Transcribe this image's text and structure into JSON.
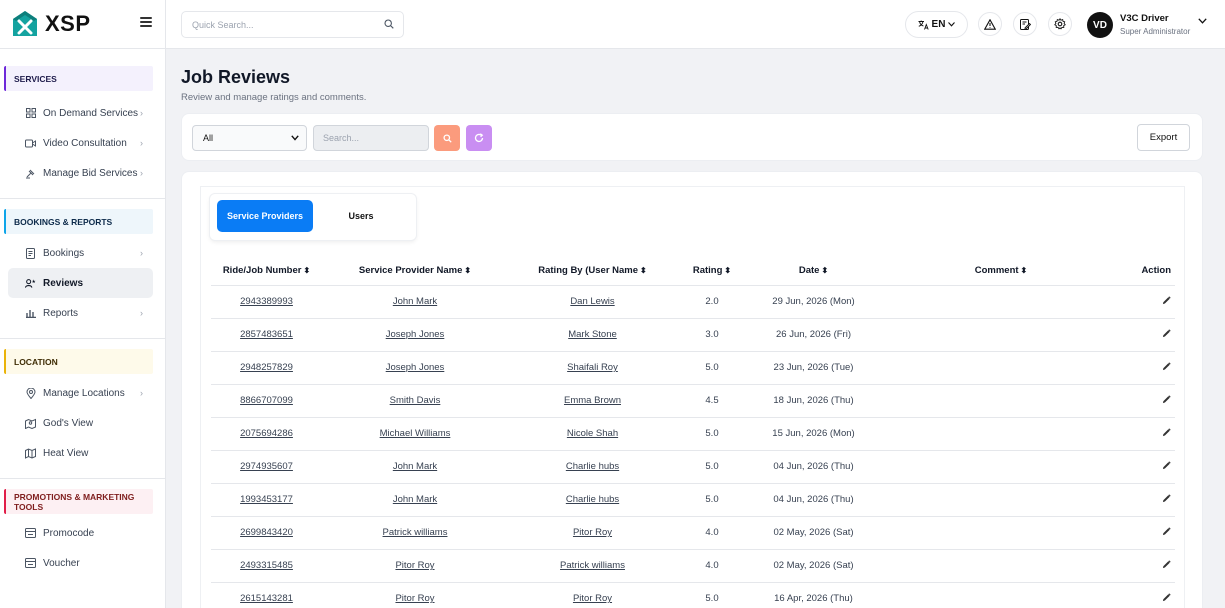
{
  "brand": {
    "name": "XSP"
  },
  "sidebar": {
    "sections": [
      {
        "title": "SERVICES",
        "items": [
          {
            "label": "On Demand Services",
            "chevron": true
          },
          {
            "label": "Video Consultation",
            "chevron": true
          },
          {
            "label": "Manage Bid Services",
            "chevron": true
          }
        ]
      },
      {
        "title": "BOOKINGS & REPORTS",
        "items": [
          {
            "label": "Bookings",
            "chevron": true
          },
          {
            "label": "Reviews",
            "active": true
          },
          {
            "label": "Reports",
            "chevron": true
          }
        ]
      },
      {
        "title": "LOCATION",
        "items": [
          {
            "label": "Manage Locations",
            "chevron": true
          },
          {
            "label": "God's View"
          },
          {
            "label": "Heat View"
          }
        ]
      },
      {
        "title": "PROMOTIONS & MARKETING TOOLS",
        "items": [
          {
            "label": "Promocode"
          },
          {
            "label": "Voucher"
          }
        ]
      }
    ]
  },
  "topbar": {
    "search_placeholder": "Quick Search...",
    "language": "EN",
    "user": {
      "initials": "VD",
      "name": "V3C Driver",
      "role": "Super Administrator"
    }
  },
  "page": {
    "title": "Job Reviews",
    "subtitle": "Review and manage ratings and comments."
  },
  "filters": {
    "select_value": "All",
    "search_placeholder": "Search...",
    "export_label": "Export"
  },
  "tabs": {
    "active": "Service Providers",
    "inactive": "Users"
  },
  "table": {
    "columns": [
      "Ride/Job Number",
      "Service Provider Name",
      "Rating By (User Name",
      "Rating",
      "Date",
      "Comment",
      "Action"
    ],
    "rows": [
      {
        "job": "2943389993",
        "provider": "John Mark",
        "user": "Dan Lewis",
        "rating": "2.0",
        "date": "29 Jun, 2026 (Mon)",
        "comment": ""
      },
      {
        "job": "2857483651",
        "provider": "Joseph Jones",
        "user": "Mark Stone",
        "rating": "3.0",
        "date": "26 Jun, 2026 (Fri)",
        "comment": ""
      },
      {
        "job": "2948257829",
        "provider": "Joseph Jones",
        "user": "Shaifali Roy",
        "rating": "5.0",
        "date": "23 Jun, 2026 (Tue)",
        "comment": ""
      },
      {
        "job": "8866707099",
        "provider": "Smith Davis",
        "user": "Emma Brown",
        "rating": "4.5",
        "date": "18 Jun, 2026 (Thu)",
        "comment": ""
      },
      {
        "job": "2075694286",
        "provider": "Michael Williams",
        "user": "Nicole Shah",
        "rating": "5.0",
        "date": "15 Jun, 2026 (Mon)",
        "comment": ""
      },
      {
        "job": "2974935607",
        "provider": "John Mark",
        "user": "Charlie hubs",
        "rating": "5.0",
        "date": "04 Jun, 2026 (Thu)",
        "comment": ""
      },
      {
        "job": "1993453177",
        "provider": "John Mark",
        "user": "Charlie hubs",
        "rating": "5.0",
        "date": "04 Jun, 2026 (Thu)",
        "comment": ""
      },
      {
        "job": "2699843420",
        "provider": "Patrick williams",
        "user": "Pitor Roy",
        "rating": "4.0",
        "date": "02 May, 2026 (Sat)",
        "comment": ""
      },
      {
        "job": "2493315485",
        "provider": "Pitor Roy",
        "user": "Patrick williams",
        "rating": "4.0",
        "date": "02 May, 2026 (Sat)",
        "comment": ""
      },
      {
        "job": "2615143281",
        "provider": "Pitor Roy",
        "user": "Pitor Roy",
        "rating": "5.0",
        "date": "16 Apr, 2026 (Thu)",
        "comment": ""
      }
    ]
  },
  "colors": {
    "primary": "#0a7cf5",
    "search_button": "#fb9b7d",
    "refresh_button": "#c98ef2",
    "logo_teal": "#14a3a0"
  }
}
